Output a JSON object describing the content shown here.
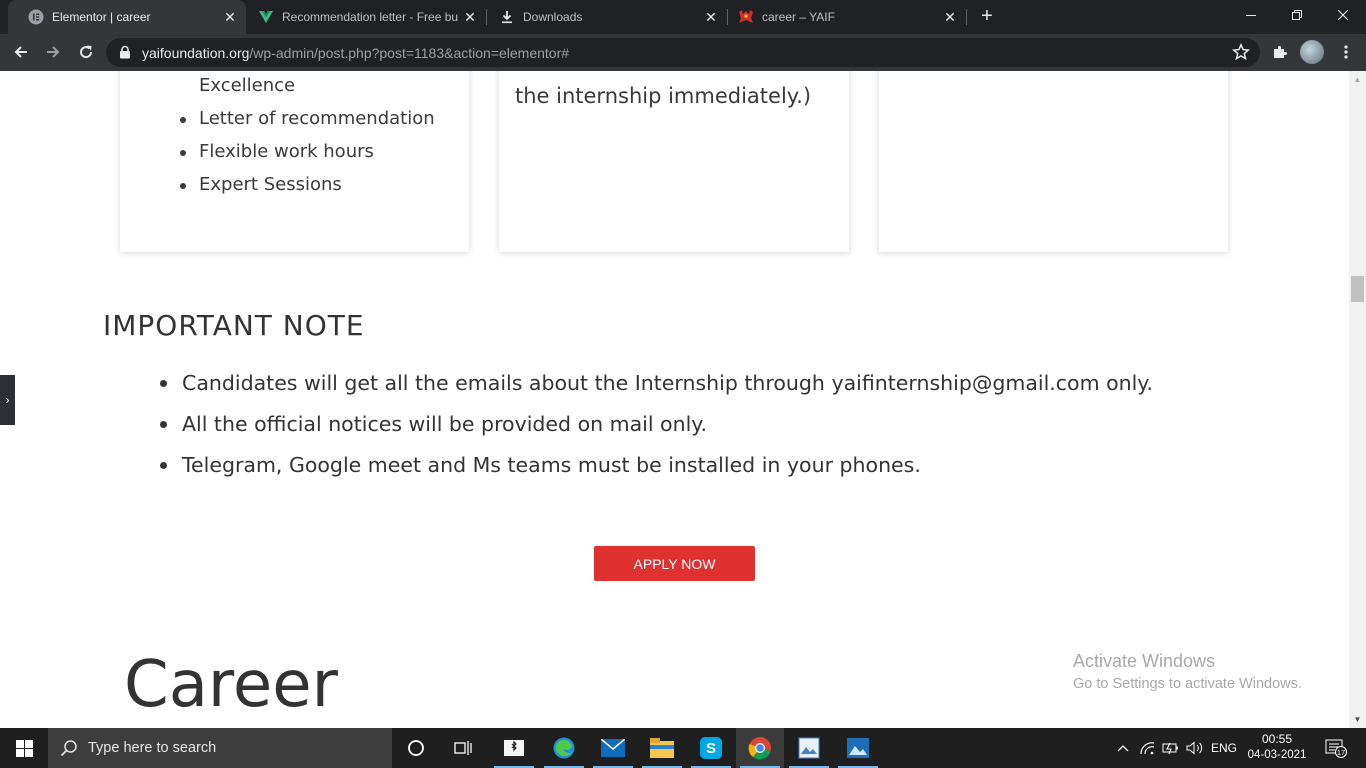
{
  "browser": {
    "tabs": [
      {
        "title": "Elementor | career",
        "icon": "elementor-favicon",
        "active": true
      },
      {
        "title": "Recommendation letter - Free bu",
        "icon": "vercel-v-favicon",
        "active": false
      },
      {
        "title": "Downloads",
        "icon": "download-icon",
        "active": false
      },
      {
        "title": "career – YAIF",
        "icon": "yaif-favicon",
        "active": false
      }
    ],
    "new_tab": "+",
    "url_host": "yaifoundation.org",
    "url_path": "/wp-admin/post.php?post=1183&action=elementor#"
  },
  "page": {
    "benefits": {
      "partial_item": "Excellence",
      "items": [
        "Letter of recommendation",
        "Flexible work hours",
        "Expert Sessions"
      ]
    },
    "card2_text": "the internship immediately.)",
    "note_title": "IMPORTANT NOTE",
    "notes": [
      "Candidates will get all the emails about the Internship through yaifinternship@gmail.com only.",
      "All the official notices will be provided on mail only.",
      "Telegram, Google meet and Ms teams must be installed in your phones."
    ],
    "apply_label": "APPLY NOW",
    "career_heading": "Career",
    "side_toggle": "›"
  },
  "watermark": {
    "line1": "Activate Windows",
    "line2": "Go to Settings to activate Windows."
  },
  "taskbar": {
    "search_placeholder": "Type here to search",
    "language": "ENG",
    "time": "00:55",
    "date": "04-03-2021",
    "notification_count": "17"
  },
  "colors": {
    "apply_button": "#e03131",
    "browser_dark": "#202124",
    "toolbar": "#35363a",
    "taskbar": "#1f1f1f"
  }
}
